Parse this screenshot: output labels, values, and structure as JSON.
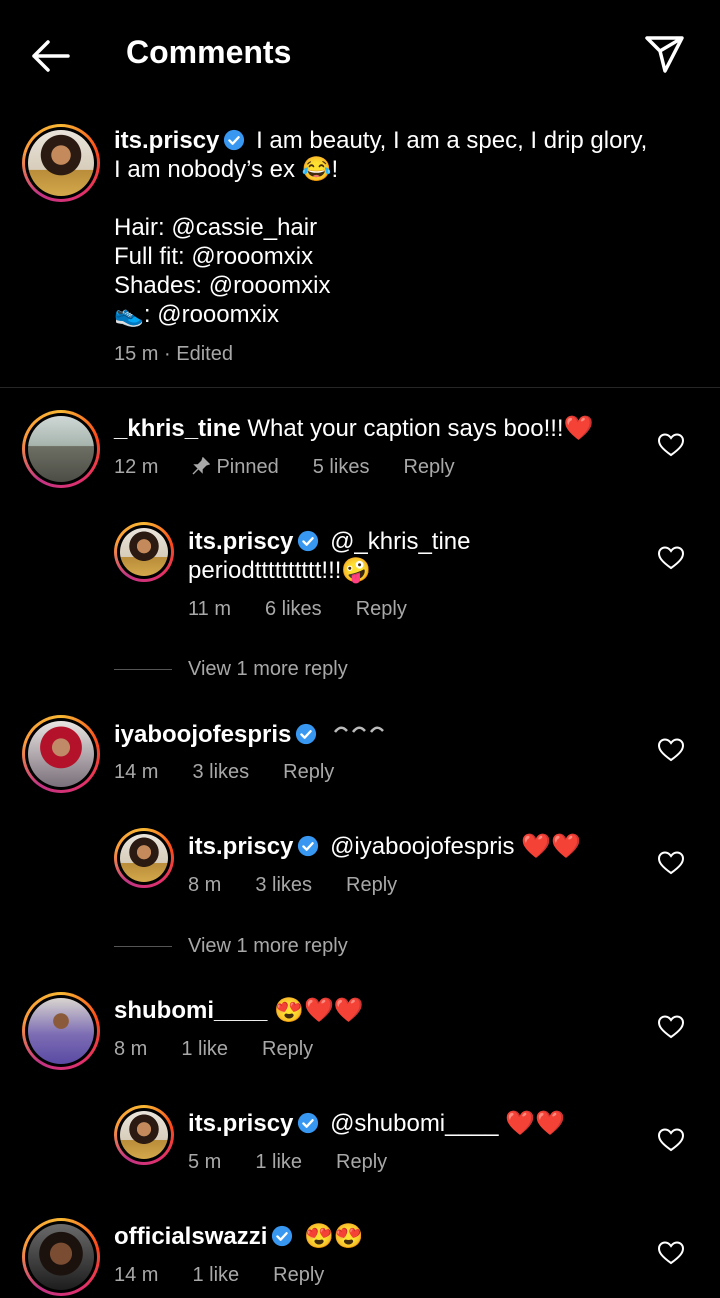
{
  "header": {
    "title": "Comments"
  },
  "caption": {
    "username": "its.priscy",
    "text_line1": "I am beauty, I am a spec, I drip glory,",
    "text_line2": "I am nobody’s ex 😂!",
    "credits": [
      "Hair: @cassie_hair",
      "Full fit: @rooomxix",
      "Shades: @rooomxix",
      "👟: @rooomxix"
    ],
    "time": "15 m · Edited"
  },
  "comments": [
    {
      "username": "_khris_tine",
      "text": "What your caption says boo!!!❤️",
      "time": "12 m",
      "pinned": "Pinned",
      "likes": "5 likes",
      "reply": "Reply"
    },
    {
      "username": "its.priscy",
      "text_line1": "@_khris_tine",
      "text_line2": "periodtttttttttt!!!🤪",
      "time": "11 m",
      "likes": "6 likes",
      "reply": "Reply"
    },
    {
      "view_more": "View 1 more reply"
    },
    {
      "username": "iyaboojofespris",
      "time": "14 m",
      "likes": "3 likes",
      "reply": "Reply"
    },
    {
      "username": "its.priscy",
      "text": "@iyaboojofespris ❤️❤️",
      "time": "8 m",
      "likes": "3 likes",
      "reply": "Reply"
    },
    {
      "view_more": "View 1 more reply"
    },
    {
      "username": "shubomi____",
      "text": "😍❤️❤️",
      "time": "8 m",
      "likes": "1 like",
      "reply": "Reply"
    },
    {
      "username": "its.priscy",
      "text": "@shubomi____ ❤️❤️",
      "time": "5 m",
      "likes": "1 like",
      "reply": "Reply"
    },
    {
      "username": "officialswazzi",
      "text": "😍😍",
      "time": "14 m",
      "likes": "1 like",
      "reply": "Reply"
    }
  ],
  "colors": {
    "background": "#000000",
    "meta": "#a8a8a8",
    "verified": "#3897f0",
    "story_ring": "#e1306c"
  }
}
